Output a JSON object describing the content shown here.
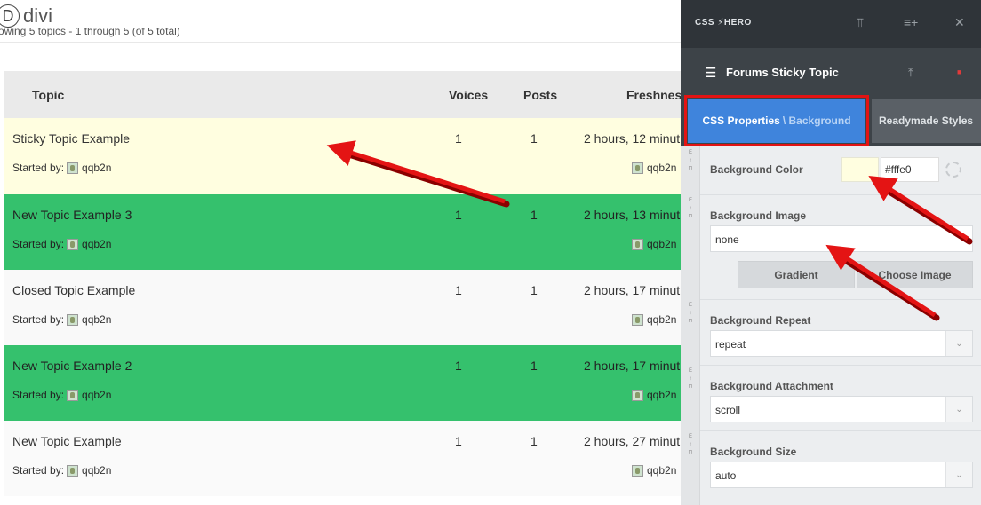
{
  "site": {
    "logo_letter": "D",
    "logo_text": "divi",
    "showing_text": "owing 5 topics - 1 through 5 (of 5 total)"
  },
  "forum": {
    "headers": {
      "topic": "Topic",
      "voices": "Voices",
      "posts": "Posts",
      "freshness": "Freshness"
    },
    "started_by_label": "Started by:",
    "rows": [
      {
        "title": "Sticky Topic Example",
        "voices": "1",
        "posts": "1",
        "freshness": "2 hours, 12 minut",
        "author": "qqb2n",
        "last_author": "qqb2n"
      },
      {
        "title": "New Topic Example 3",
        "voices": "1",
        "posts": "1",
        "freshness": "2 hours, 13 minut",
        "author": "qqb2n",
        "last_author": "qqb2n"
      },
      {
        "title": "Closed Topic Example",
        "voices": "1",
        "posts": "1",
        "freshness": "2 hours, 17 minut",
        "author": "qqb2n",
        "last_author": "qqb2n"
      },
      {
        "title": "New Topic Example 2",
        "voices": "1",
        "posts": "1",
        "freshness": "2 hours, 17 minut",
        "author": "qqb2n",
        "last_author": "qqb2n"
      },
      {
        "title": "New Topic Example",
        "voices": "1",
        "posts": "1",
        "freshness": "2 hours, 27 minut",
        "author": "qqb2n",
        "last_author": "qqb2n"
      }
    ]
  },
  "panel": {
    "brand": "CSS ⚡HERO",
    "element_title": "Forums Sticky Topic",
    "tabs": {
      "active_label": "CSS Properties",
      "active_crumb": "\\ Background",
      "other_label": "Readymade Styles"
    },
    "gutter_letter": "E",
    "properties": {
      "bg_color_label": "Background Color",
      "bg_color_value": "#fffe0",
      "bg_image_label": "Background Image",
      "bg_image_value": "none",
      "gradient_button": "Gradient",
      "choose_image_button": "Choose Image",
      "bg_repeat_label": "Background Repeat",
      "bg_repeat_value": "repeat",
      "bg_attachment_label": "Background Attachment",
      "bg_attachment_value": "scroll",
      "bg_size_label": "Background Size",
      "bg_size_value": "auto"
    }
  },
  "colors": {
    "sticky_bg": "#fffee0",
    "green_row": "#35c16d",
    "accent_blue": "#3f84dc",
    "highlight_red": "#e31313"
  }
}
